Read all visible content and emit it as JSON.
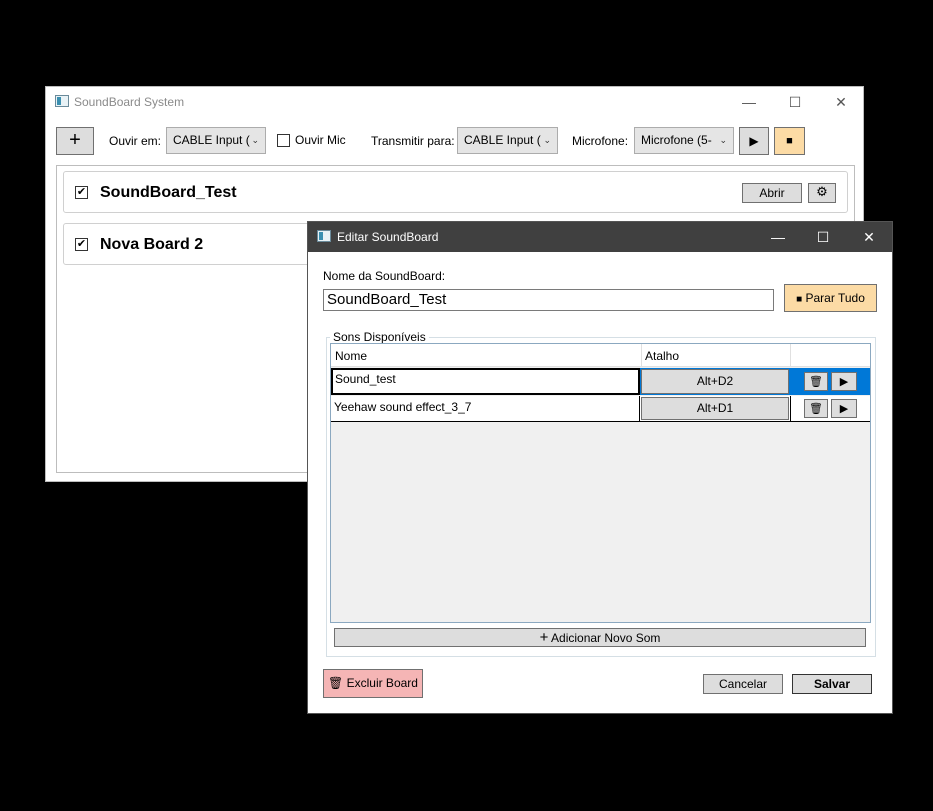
{
  "main_window": {
    "title": "SoundBoard System",
    "controls": {
      "minimize": "—",
      "maximize": "☐",
      "close": "✕"
    },
    "toolbar": {
      "add_label": "+",
      "ouvir_em_label": "Ouvir em:",
      "ouvir_em_value": "CABLE Input (",
      "ouvir_mic_label": "Ouvir Mic",
      "transmitir_label": "Transmitir para:",
      "transmitir_value": "CABLE Input (",
      "microfone_label": "Microfone:",
      "microfone_value": "Microfone (5-",
      "play_glyph": "▶",
      "stop_glyph": "■"
    },
    "boards": [
      {
        "name": "SoundBoard_Test",
        "checked": "✔",
        "open_label": "Abrir"
      },
      {
        "name": "Nova Board 2",
        "checked": "✔"
      }
    ]
  },
  "dialog": {
    "title": "Editar SoundBoard",
    "controls": {
      "minimize": "—",
      "maximize": "☐",
      "close": "✕"
    },
    "name_label": "Nome da SoundBoard:",
    "name_value": "SoundBoard_Test",
    "stop_all_label": "Parar Tudo",
    "stop_glyph": "■",
    "group_label": "Sons Disponíveis",
    "columns": {
      "name": "Nome",
      "shortcut": "Atalho"
    },
    "sounds": [
      {
        "name": "Sound_test",
        "shortcut": "Alt+D2"
      },
      {
        "name": "Yeehaw sound effect_3_7",
        "shortcut": "Alt+D1"
      }
    ],
    "add_sound_label": "Adicionar Novo Som",
    "add_glyph": "+",
    "delete_board_label": "Excluir Board",
    "cancel_label": "Cancelar",
    "save_label": "Salvar",
    "play_glyph": "▶"
  },
  "colors": {
    "selection": "#0078d7",
    "stop_button_bg": "#fcdba5",
    "delete_button_bg": "#f5b5b5",
    "dialog_titlebar": "#404040"
  }
}
